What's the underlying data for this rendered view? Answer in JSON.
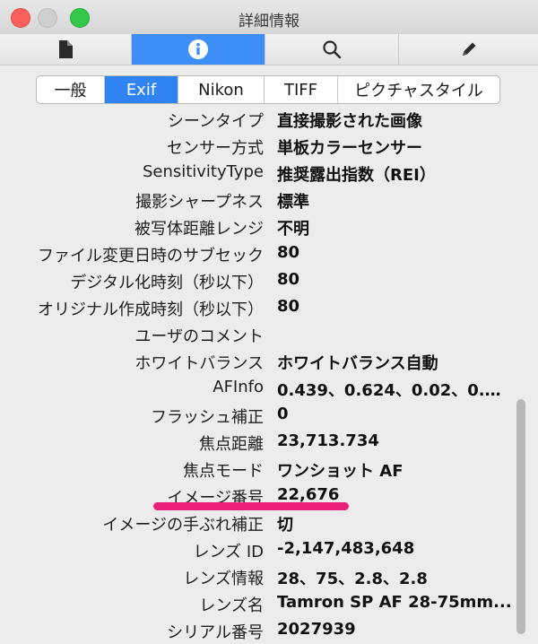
{
  "window": {
    "title": "詳細情報"
  },
  "toolbar": {
    "tabs": [
      {
        "icon": "document-icon"
      },
      {
        "icon": "info-icon",
        "active": true
      },
      {
        "icon": "search-icon"
      },
      {
        "icon": "pencil-icon"
      }
    ]
  },
  "segments": [
    {
      "label": "一般"
    },
    {
      "label": "Exif",
      "active": true
    },
    {
      "label": "Nikon"
    },
    {
      "label": "TIFF"
    },
    {
      "label": "ピクチャスタイル"
    }
  ],
  "rows": [
    {
      "label": "シーンタイプ",
      "value": "直接撮影された画像"
    },
    {
      "label": "センサー方式",
      "value": "単板カラーセンサー"
    },
    {
      "label": "SensitivityType",
      "value": "推奨露出指数（REI）"
    },
    {
      "label": "撮影シャープネス",
      "value": "標準"
    },
    {
      "label": "被写体距離レンジ",
      "value": "不明"
    },
    {
      "label": "ファイル変更日時のサブセック",
      "value": "80"
    },
    {
      "label": "デジタル化時刻（秒以下）",
      "value": "80"
    },
    {
      "label": "オリジナル作成時刻（秒以下）",
      "value": "80"
    },
    {
      "label": "ユーザのコメント",
      "value": ""
    },
    {
      "label": "ホワイトバランス",
      "value": "ホワイトバランス自動"
    },
    {
      "label": "AFInfo",
      "value": "0.439、0.624、0.02、0.0..."
    },
    {
      "label": "フラッシュ補正",
      "value": "0"
    },
    {
      "label": "焦点距離",
      "value": "23,713.734"
    },
    {
      "label": "焦点モード",
      "value": "ワンショット AF"
    },
    {
      "label": "イメージ番号",
      "value": "22,676",
      "highlighted": true
    },
    {
      "label": "イメージの手ぶれ補正",
      "value": "切"
    },
    {
      "label": "レンズ ID",
      "value": "-2,147,483,648"
    },
    {
      "label": "レンズ情報",
      "value": "28、75、2.8、2.8"
    },
    {
      "label": "レンズ名",
      "value": "Tamron SP AF 28-75mm..."
    },
    {
      "label": "シリアル番号",
      "value": "2027939"
    }
  ],
  "colors": {
    "accent": "#2f83f3",
    "highlight_underline": "#ea1f79"
  }
}
